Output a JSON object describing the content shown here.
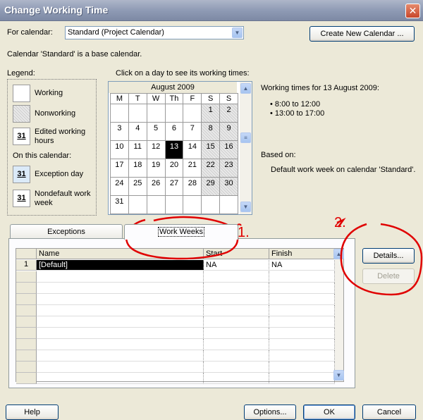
{
  "window": {
    "title": "Change Working Time"
  },
  "for_calendar": {
    "label": "For calendar:",
    "value": "Standard (Project Calendar)"
  },
  "create_calendar_button": "Create New Calendar ...",
  "base_calendar_note": "Calendar 'Standard' is a base calendar.",
  "legend": {
    "heading": "Legend:",
    "working": "Working",
    "nonworking": "Nonworking",
    "edited": "Edited working hours",
    "on_this_calendar": "On this calendar:",
    "exception": "Exception day",
    "nondefault": "Nondefault work week",
    "swatch_number": "31"
  },
  "calendar": {
    "instruction": "Click on a day to see its working times:",
    "month": "August 2009",
    "weekdays": [
      "M",
      "T",
      "W",
      "Th",
      "F",
      "S",
      "S"
    ],
    "weeks": [
      [
        "",
        "",
        "",
        "",
        "",
        "1",
        "2"
      ],
      [
        "3",
        "4",
        "5",
        "6",
        "7",
        "8",
        "9"
      ],
      [
        "10",
        "11",
        "12",
        "13",
        "14",
        "15",
        "16"
      ],
      [
        "17",
        "18",
        "19",
        "20",
        "21",
        "22",
        "23"
      ],
      [
        "24",
        "25",
        "26",
        "27",
        "28",
        "29",
        "30"
      ],
      [
        "31",
        "",
        "",
        "",
        "",
        "",
        ""
      ]
    ],
    "selected_day": "13"
  },
  "working_times": {
    "heading": "Working times for 13 August 2009:",
    "slots": [
      "8:00 to 12:00",
      "13:00 to 17:00"
    ],
    "based_on_label": "Based on:",
    "based_on_value": "Default work week on calendar 'Standard'."
  },
  "tabs": {
    "exceptions": "Exceptions",
    "work_weeks": "Work Weeks"
  },
  "grid": {
    "columns": [
      "Name",
      "Start",
      "Finish"
    ],
    "rows": [
      {
        "num": "1",
        "name": "[Default]",
        "start": "NA",
        "finish": "NA"
      }
    ]
  },
  "side_buttons": {
    "details": "Details...",
    "delete": "Delete"
  },
  "footer": {
    "help": "Help",
    "options": "Options...",
    "ok": "OK",
    "cancel": "Cancel"
  },
  "annotations": {
    "mark1": "1.",
    "mark2": "2."
  }
}
